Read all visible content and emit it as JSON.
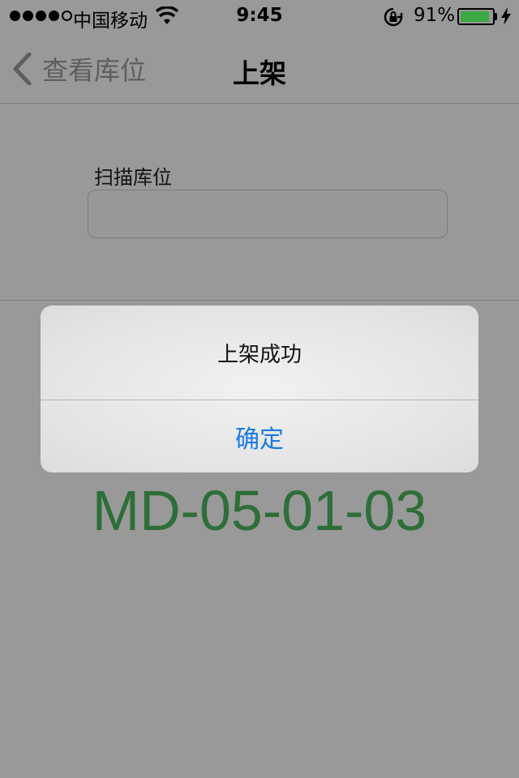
{
  "status_bar": {
    "carrier": "中国移动",
    "time": "9:45",
    "battery_percent": "91%",
    "battery_level": 0.91,
    "signal_bars": 4,
    "icons": [
      "wifi-icon",
      "rotation-lock-icon",
      "battery-icon",
      "charging-bolt-icon"
    ]
  },
  "nav": {
    "back_label": "查看库位",
    "title": "上架"
  },
  "form": {
    "field_label": "扫描库位",
    "field_value": "",
    "field_placeholder": ""
  },
  "main": {
    "location_code": "MD-05-01-03"
  },
  "alert": {
    "message": "上架成功",
    "confirm_label": "确定"
  },
  "colors": {
    "background": "#999999",
    "accent": "#1a7ae6",
    "location_code": "#2e6e38",
    "battery": "#3aa843"
  }
}
